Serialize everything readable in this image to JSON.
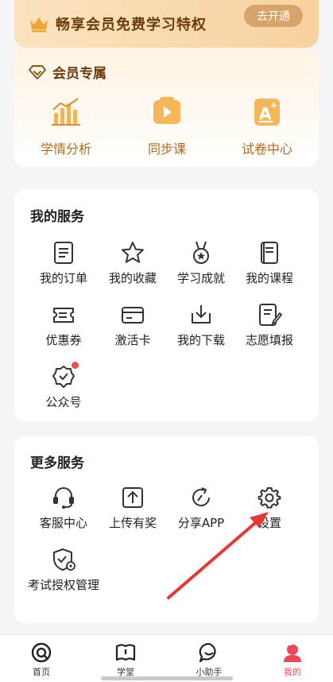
{
  "vip_banner": {
    "title": "畅享会员免费学习特权",
    "open_button": "去开通"
  },
  "vip_section": {
    "title": "会员专属",
    "items": [
      {
        "label": "学情分析",
        "icon": "chart-icon"
      },
      {
        "label": "同步课",
        "icon": "video-play-icon"
      },
      {
        "label": "试卷中心",
        "icon": "exam-paper-icon"
      }
    ]
  },
  "my_services": {
    "title": "我的服务",
    "items": [
      {
        "label": "我的订单",
        "icon": "order-icon"
      },
      {
        "label": "我的收藏",
        "icon": "star-icon"
      },
      {
        "label": "学习成就",
        "icon": "medal-icon"
      },
      {
        "label": "我的课程",
        "icon": "course-icon"
      },
      {
        "label": "优惠券",
        "icon": "coupon-icon"
      },
      {
        "label": "激活卡",
        "icon": "card-icon"
      },
      {
        "label": "我的下载",
        "icon": "download-icon"
      },
      {
        "label": "志愿填报",
        "icon": "form-edit-icon"
      },
      {
        "label": "公众号",
        "icon": "official-account-icon",
        "badge": "red-dot"
      }
    ]
  },
  "more_services": {
    "title": "更多服务",
    "items": [
      {
        "label": "客服中心",
        "icon": "headset-icon"
      },
      {
        "label": "上传有奖",
        "icon": "upload-icon"
      },
      {
        "label": "分享APP",
        "icon": "share-icon"
      },
      {
        "label": "设置",
        "icon": "gear-icon"
      },
      {
        "label": "考试授权管理",
        "icon": "shield-gear-icon"
      }
    ]
  },
  "tabbar": {
    "items": [
      {
        "label": "首页",
        "icon": "home-icon",
        "active": false
      },
      {
        "label": "学堂",
        "icon": "book-icon",
        "active": false
      },
      {
        "label": "小助手",
        "icon": "chat-icon",
        "active": false
      },
      {
        "label": "我的",
        "icon": "profile-icon",
        "active": true
      }
    ]
  },
  "colors": {
    "accent": "#e8495a",
    "vip_text": "#6b3d0e",
    "vip_item": "#b06b1e",
    "arrow": "#e53935"
  }
}
